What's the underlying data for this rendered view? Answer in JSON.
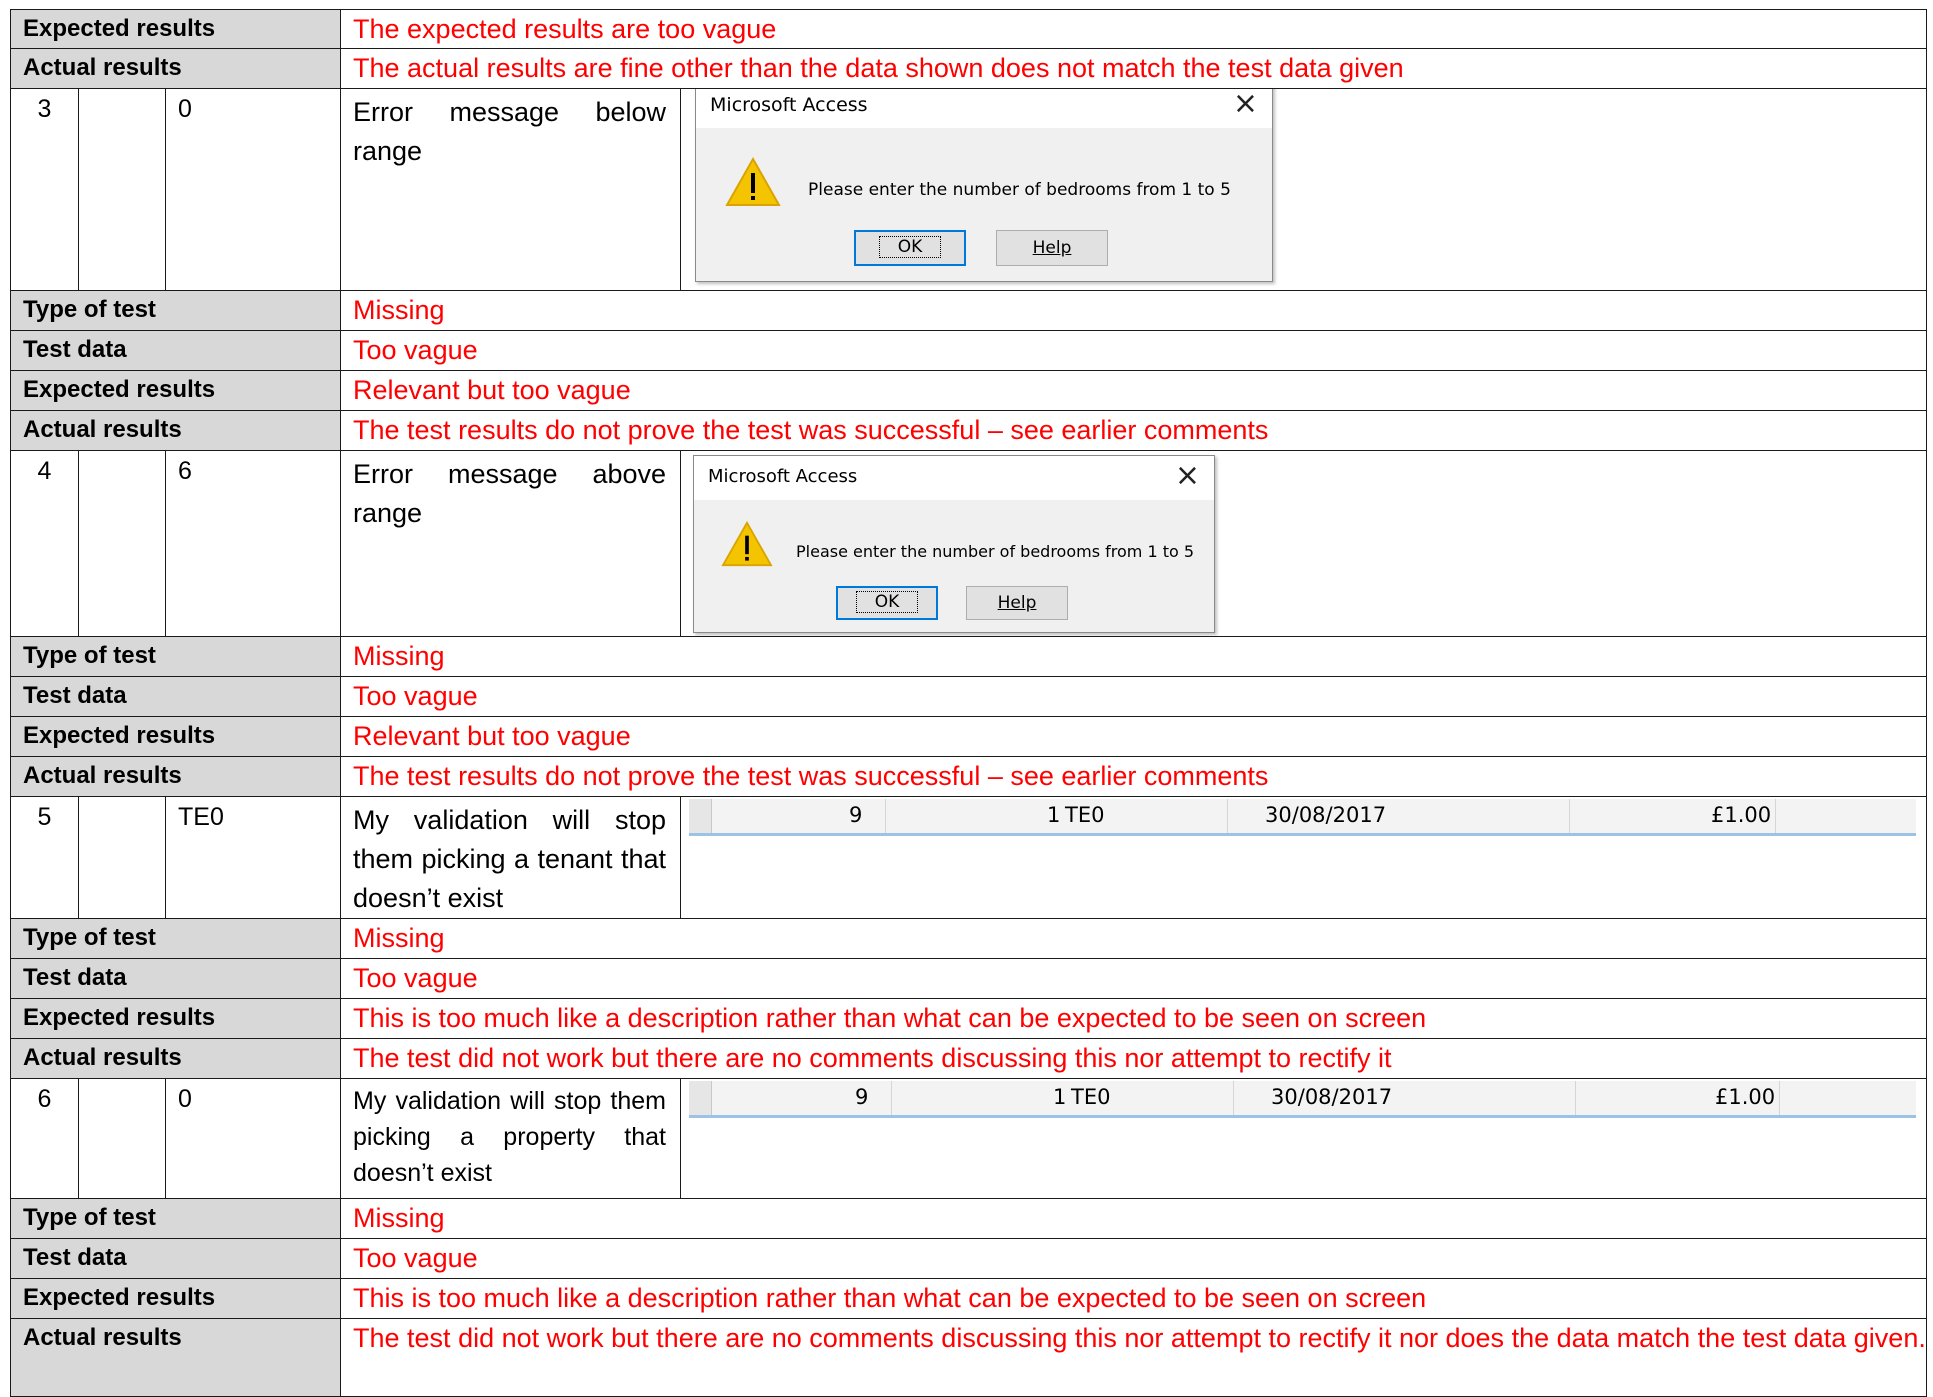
{
  "labels": {
    "type_of_test": "Type of test",
    "test_data": "Test data",
    "expected_results": "Expected results",
    "actual_results": "Actual results"
  },
  "top": {
    "expected": "The expected results are too vague",
    "actual": "The actual results are fine other than the data shown does not match the test data given"
  },
  "tests": [
    {
      "number": "3",
      "data": "0",
      "description": "Error message below range",
      "dialog": {
        "title": "Microsoft Access",
        "message": "Please enter the number of bedrooms from 1 to 5",
        "ok": "OK",
        "help": "Help"
      },
      "type": "Missing",
      "test_data": "Too vague",
      "expected": "Relevant but too vague",
      "actual": "The test results do not prove the test was successful – see earlier comments"
    },
    {
      "number": "4",
      "data": "6",
      "description": "Error message above range",
      "dialog": {
        "title": "Microsoft Access",
        "message": "Please enter the number of bedrooms from 1 to 5",
        "ok": "OK",
        "help": "Help"
      },
      "type": "Missing",
      "test_data": "Too vague",
      "expected": "Relevant but too vague",
      "actual": "The test results do not prove the test was successful – see earlier comments"
    },
    {
      "number": "5",
      "data": "TE0",
      "description": "My validation will stop them picking a tenant that doesn’t exist",
      "datasheet": {
        "id": "9",
        "property": "1",
        "tenant": "TE0",
        "date": "30/08/2017",
        "amount": "£1.00"
      },
      "type": "Missing",
      "test_data": "Too vague",
      "expected": "This is too much like a description rather than what can be expected to be seen on screen",
      "actual": "The test did not work but there are no comments discussing this nor attempt to rectify it"
    },
    {
      "number": "6",
      "data": "0",
      "description": "My validation will stop them picking a property that doesn’t exist",
      "datasheet": {
        "id": "9",
        "property": "1",
        "tenant": "TE0",
        "date": "30/08/2017",
        "amount": "£1.00"
      },
      "type": "Missing",
      "test_data": "Too vague",
      "expected": "This is too much like a description rather than what can be expected to be seen on screen",
      "actual": "The test did not work but there are no comments discussing this nor attempt to rectify it nor does the data match the test data given."
    }
  ],
  "colors": {
    "comment": "#ff0000",
    "label_bg": "#d8d8d8",
    "warning": "#f5c400"
  },
  "icons": {
    "warning": "warning-icon",
    "close": "close-icon"
  }
}
